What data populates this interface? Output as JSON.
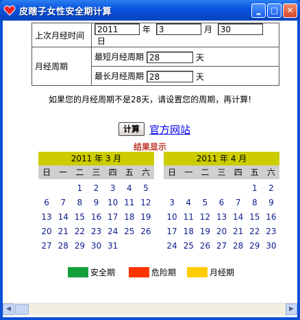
{
  "window": {
    "title": "皮瞎子女性安全期计算"
  },
  "settings": {
    "last_period_label": "上次月经时间",
    "year_value": "2011",
    "year_unit": "年",
    "month_value": "3",
    "month_unit": "月",
    "day_value": "30",
    "day_unit": "日",
    "cycle_label": "月经周期",
    "min_label": "最短月经周期",
    "min_value": "28",
    "max_label": "最长月经周期",
    "max_value": "28",
    "day_suffix": "天"
  },
  "note": "如果您的月经周期不是28天，请设置您的周期，再计算!",
  "actions": {
    "calc_label": "计算",
    "site_link": "官方网站"
  },
  "result_title": "结果显示",
  "weekdays": [
    "日",
    "一",
    "二",
    "三",
    "四",
    "五",
    "六"
  ],
  "calendars": [
    {
      "header": "2011 年  3 月",
      "days": [
        "",
        "",
        "1",
        "2",
        "3",
        "4",
        "5",
        "6",
        "7",
        "8",
        "9",
        "10",
        "11",
        "12",
        "13",
        "14",
        "15",
        "16",
        "17",
        "18",
        "19",
        "20",
        "21",
        "22",
        "23",
        "24",
        "25",
        "26",
        "27",
        "28",
        "29",
        "30",
        "31",
        "",
        ""
      ]
    },
    {
      "header": "2011 年  4 月",
      "days": [
        "",
        "",
        "",
        "",
        "",
        "1",
        "2",
        "3",
        "4",
        "5",
        "6",
        "7",
        "8",
        "9",
        "10",
        "11",
        "12",
        "13",
        "14",
        "15",
        "16",
        "17",
        "18",
        "19",
        "20",
        "21",
        "22",
        "23",
        "24",
        "25",
        "26",
        "27",
        "28",
        "29",
        "30"
      ]
    }
  ],
  "legend": [
    {
      "label": "安全期",
      "color": "#12a03a"
    },
    {
      "label": "危险期",
      "color": "#ff3300"
    },
    {
      "label": "月经期",
      "color": "#ffcc00"
    }
  ],
  "colors": {
    "calendar_header": "#cccc00",
    "weekday_bar": "#cfcfcf",
    "day_text": "#0a1a8c"
  }
}
